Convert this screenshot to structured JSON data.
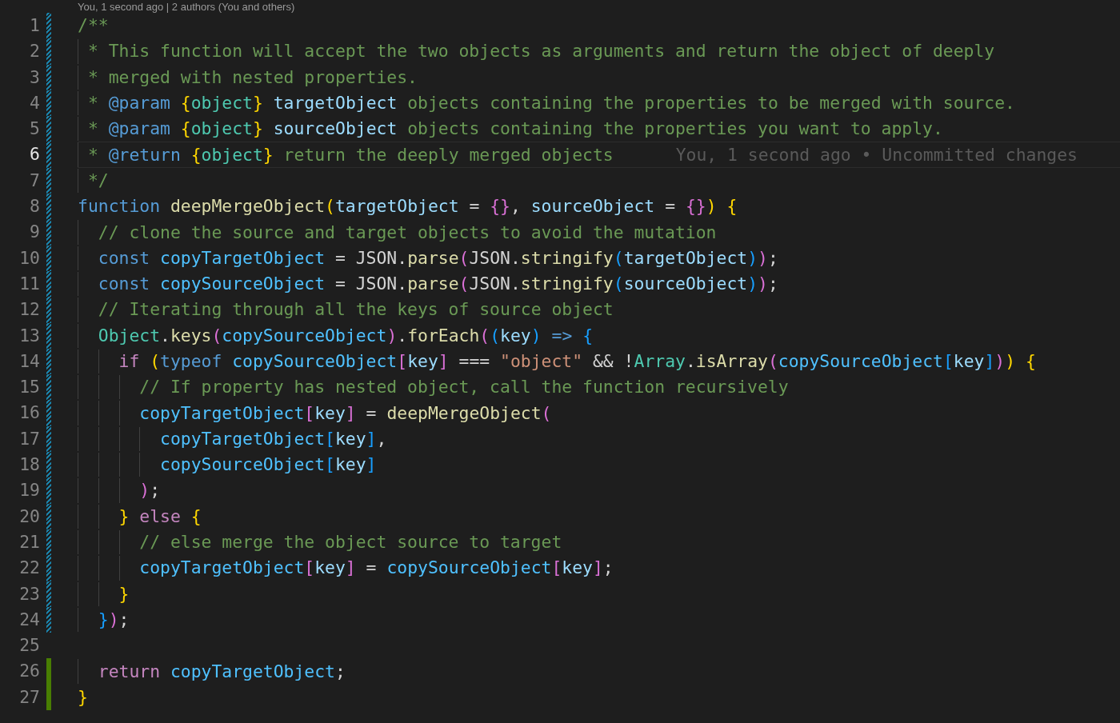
{
  "codelens": "You, 1 second ago | 2 authors (You and others)",
  "lines": [
    {
      "number": "1",
      "modified": true,
      "added": false,
      "current": false,
      "tokens": [
        {
          "kind": "comment",
          "text": "/**"
        }
      ]
    },
    {
      "number": "2",
      "modified": true,
      "added": false,
      "current": false,
      "tokens": [
        {
          "kind": "comment",
          "text": " * This function will accept the two objects as arguments and return the object of deeply"
        }
      ]
    },
    {
      "number": "3",
      "modified": true,
      "added": false,
      "current": false,
      "tokens": [
        {
          "kind": "comment",
          "text": " * merged with nested properties."
        }
      ]
    },
    {
      "number": "4",
      "modified": true,
      "added": false,
      "current": false,
      "tokens": [
        {
          "kind": "comment",
          "text": " * "
        },
        {
          "kind": "keyword",
          "text": "@param "
        },
        {
          "kind": "bracket1",
          "text": "{"
        },
        {
          "kind": "type",
          "text": "object"
        },
        {
          "kind": "bracket1",
          "text": "} "
        },
        {
          "kind": "variable",
          "text": "targetObject"
        },
        {
          "kind": "comment",
          "text": " objects containing the properties to be merged with source."
        }
      ]
    },
    {
      "number": "5",
      "modified": true,
      "added": false,
      "current": false,
      "tokens": [
        {
          "kind": "comment",
          "text": " * "
        },
        {
          "kind": "keyword",
          "text": "@param "
        },
        {
          "kind": "bracket1",
          "text": "{"
        },
        {
          "kind": "type",
          "text": "object"
        },
        {
          "kind": "bracket1",
          "text": "} "
        },
        {
          "kind": "variable",
          "text": "sourceObject"
        },
        {
          "kind": "comment",
          "text": " objects containing the properties you want to apply."
        }
      ]
    },
    {
      "number": "6",
      "modified": true,
      "added": false,
      "current": true,
      "blame": "You, 1 second ago • Uncommitted changes",
      "tokens": [
        {
          "kind": "comment",
          "text": " * "
        },
        {
          "kind": "keyword",
          "text": "@return "
        },
        {
          "kind": "bracket1",
          "text": "{"
        },
        {
          "kind": "type",
          "text": "object"
        },
        {
          "kind": "bracket1",
          "text": "}"
        },
        {
          "kind": "comment",
          "text": " return the deeply merged objects"
        }
      ]
    },
    {
      "number": "7",
      "modified": true,
      "added": false,
      "current": false,
      "tokens": [
        {
          "kind": "comment",
          "text": " */"
        }
      ]
    },
    {
      "number": "8",
      "modified": true,
      "added": false,
      "current": false,
      "tokens": [
        {
          "kind": "keyword",
          "text": "function "
        },
        {
          "kind": "function",
          "text": "deepMergeObject"
        },
        {
          "kind": "bracket1",
          "text": "("
        },
        {
          "kind": "variable",
          "text": "targetObject"
        },
        {
          "kind": "plain",
          "text": " = "
        },
        {
          "kind": "bracket2",
          "text": "{}"
        },
        {
          "kind": "plain",
          "text": ", "
        },
        {
          "kind": "variable",
          "text": "sourceObject"
        },
        {
          "kind": "plain",
          "text": " = "
        },
        {
          "kind": "bracket2",
          "text": "{}"
        },
        {
          "kind": "bracket1",
          "text": ") {"
        }
      ]
    },
    {
      "number": "9",
      "modified": true,
      "added": false,
      "current": false,
      "tokens": [
        {
          "kind": "comment",
          "text": "  // clone the source and target objects to avoid the mutation"
        }
      ]
    },
    {
      "number": "10",
      "modified": true,
      "added": false,
      "current": false,
      "tokens": [
        {
          "kind": "keyword",
          "text": "  const "
        },
        {
          "kind": "constant",
          "text": "copyTargetObject"
        },
        {
          "kind": "plain",
          "text": " = JSON."
        },
        {
          "kind": "function",
          "text": "parse"
        },
        {
          "kind": "bracket2",
          "text": "("
        },
        {
          "kind": "plain",
          "text": "JSON."
        },
        {
          "kind": "function",
          "text": "stringify"
        },
        {
          "kind": "bracket3",
          "text": "("
        },
        {
          "kind": "variable",
          "text": "targetObject"
        },
        {
          "kind": "bracket3",
          "text": ")"
        },
        {
          "kind": "bracket2",
          "text": ")"
        },
        {
          "kind": "plain",
          "text": ";"
        }
      ]
    },
    {
      "number": "11",
      "modified": true,
      "added": false,
      "current": false,
      "tokens": [
        {
          "kind": "keyword",
          "text": "  const "
        },
        {
          "kind": "constant",
          "text": "copySourceObject"
        },
        {
          "kind": "plain",
          "text": " = JSON."
        },
        {
          "kind": "function",
          "text": "parse"
        },
        {
          "kind": "bracket2",
          "text": "("
        },
        {
          "kind": "plain",
          "text": "JSON."
        },
        {
          "kind": "function",
          "text": "stringify"
        },
        {
          "kind": "bracket3",
          "text": "("
        },
        {
          "kind": "variable",
          "text": "sourceObject"
        },
        {
          "kind": "bracket3",
          "text": ")"
        },
        {
          "kind": "bracket2",
          "text": ")"
        },
        {
          "kind": "plain",
          "text": ";"
        }
      ]
    },
    {
      "number": "12",
      "modified": true,
      "added": false,
      "current": false,
      "tokens": [
        {
          "kind": "comment",
          "text": "  // Iterating through all the keys of source object"
        }
      ]
    },
    {
      "number": "13",
      "modified": true,
      "added": false,
      "current": false,
      "tokens": [
        {
          "kind": "type",
          "text": "  Object"
        },
        {
          "kind": "plain",
          "text": "."
        },
        {
          "kind": "function",
          "text": "keys"
        },
        {
          "kind": "bracket2",
          "text": "("
        },
        {
          "kind": "constant",
          "text": "copySourceObject"
        },
        {
          "kind": "bracket2",
          "text": ")"
        },
        {
          "kind": "plain",
          "text": "."
        },
        {
          "kind": "function",
          "text": "forEach"
        },
        {
          "kind": "bracket2",
          "text": "("
        },
        {
          "kind": "bracket3",
          "text": "("
        },
        {
          "kind": "variable",
          "text": "key"
        },
        {
          "kind": "bracket3",
          "text": ")"
        },
        {
          "kind": "keyword",
          "text": " => "
        },
        {
          "kind": "bracket3",
          "text": "{"
        }
      ]
    },
    {
      "number": "14",
      "modified": true,
      "added": false,
      "current": false,
      "tokens": [
        {
          "kind": "control",
          "text": "    if "
        },
        {
          "kind": "bracket1",
          "text": "("
        },
        {
          "kind": "keyword",
          "text": "typeof "
        },
        {
          "kind": "constant",
          "text": "copySourceObject"
        },
        {
          "kind": "bracket2",
          "text": "["
        },
        {
          "kind": "variable",
          "text": "key"
        },
        {
          "kind": "bracket2",
          "text": "]"
        },
        {
          "kind": "plain",
          "text": " === "
        },
        {
          "kind": "string",
          "text": "\"object\""
        },
        {
          "kind": "plain",
          "text": " && !"
        },
        {
          "kind": "type",
          "text": "Array"
        },
        {
          "kind": "plain",
          "text": "."
        },
        {
          "kind": "function",
          "text": "isArray"
        },
        {
          "kind": "bracket2",
          "text": "("
        },
        {
          "kind": "constant",
          "text": "copySourceObject"
        },
        {
          "kind": "bracket3",
          "text": "["
        },
        {
          "kind": "variable",
          "text": "key"
        },
        {
          "kind": "bracket3",
          "text": "]"
        },
        {
          "kind": "bracket2",
          "text": ")"
        },
        {
          "kind": "bracket1",
          "text": ") {"
        }
      ]
    },
    {
      "number": "15",
      "modified": true,
      "added": false,
      "current": false,
      "tokens": [
        {
          "kind": "comment",
          "text": "      // If property has nested object, call the function recursively"
        }
      ]
    },
    {
      "number": "16",
      "modified": true,
      "added": false,
      "current": false,
      "tokens": [
        {
          "kind": "constant",
          "text": "      copyTargetObject"
        },
        {
          "kind": "bracket2",
          "text": "["
        },
        {
          "kind": "variable",
          "text": "key"
        },
        {
          "kind": "bracket2",
          "text": "]"
        },
        {
          "kind": "plain",
          "text": " = "
        },
        {
          "kind": "function",
          "text": "deepMergeObject"
        },
        {
          "kind": "bracket2",
          "text": "("
        }
      ]
    },
    {
      "number": "17",
      "modified": true,
      "added": false,
      "current": false,
      "tokens": [
        {
          "kind": "constant",
          "text": "        copyTargetObject"
        },
        {
          "kind": "bracket3",
          "text": "["
        },
        {
          "kind": "variable",
          "text": "key"
        },
        {
          "kind": "bracket3",
          "text": "]"
        },
        {
          "kind": "plain",
          "text": ","
        }
      ]
    },
    {
      "number": "18",
      "modified": true,
      "added": false,
      "current": false,
      "tokens": [
        {
          "kind": "constant",
          "text": "        copySourceObject"
        },
        {
          "kind": "bracket3",
          "text": "["
        },
        {
          "kind": "variable",
          "text": "key"
        },
        {
          "kind": "bracket3",
          "text": "]"
        }
      ]
    },
    {
      "number": "19",
      "modified": true,
      "added": false,
      "current": false,
      "tokens": [
        {
          "kind": "bracket2",
          "text": "      )"
        },
        {
          "kind": "plain",
          "text": ";"
        }
      ]
    },
    {
      "number": "20",
      "modified": true,
      "added": false,
      "current": false,
      "tokens": [
        {
          "kind": "bracket1",
          "text": "    } "
        },
        {
          "kind": "control",
          "text": "else "
        },
        {
          "kind": "bracket1",
          "text": "{"
        }
      ]
    },
    {
      "number": "21",
      "modified": true,
      "added": false,
      "current": false,
      "tokens": [
        {
          "kind": "comment",
          "text": "      // else merge the object source to target"
        }
      ]
    },
    {
      "number": "22",
      "modified": true,
      "added": false,
      "current": false,
      "tokens": [
        {
          "kind": "constant",
          "text": "      copyTargetObject"
        },
        {
          "kind": "bracket2",
          "text": "["
        },
        {
          "kind": "variable",
          "text": "key"
        },
        {
          "kind": "bracket2",
          "text": "]"
        },
        {
          "kind": "plain",
          "text": " = "
        },
        {
          "kind": "constant",
          "text": "copySourceObject"
        },
        {
          "kind": "bracket2",
          "text": "["
        },
        {
          "kind": "variable",
          "text": "key"
        },
        {
          "kind": "bracket2",
          "text": "]"
        },
        {
          "kind": "plain",
          "text": ";"
        }
      ]
    },
    {
      "number": "23",
      "modified": true,
      "added": false,
      "current": false,
      "tokens": [
        {
          "kind": "bracket1",
          "text": "    }"
        }
      ]
    },
    {
      "number": "24",
      "modified": true,
      "added": false,
      "current": false,
      "tokens": [
        {
          "kind": "bracket3",
          "text": "  }"
        },
        {
          "kind": "bracket2",
          "text": ")"
        },
        {
          "kind": "plain",
          "text": ";"
        }
      ]
    },
    {
      "number": "25",
      "current": false
    },
    {
      "number": "26",
      "modified": false,
      "added": true,
      "current": false,
      "tokens": [
        {
          "kind": "control",
          "text": "  return "
        },
        {
          "kind": "constant",
          "text": "copyTargetObject"
        },
        {
          "kind": "plain",
          "text": ";"
        }
      ]
    },
    {
      "number": "27",
      "modified": false,
      "added": true,
      "current": false,
      "tokens": [
        {
          "kind": "bracket1",
          "text": "}"
        }
      ]
    }
  ]
}
